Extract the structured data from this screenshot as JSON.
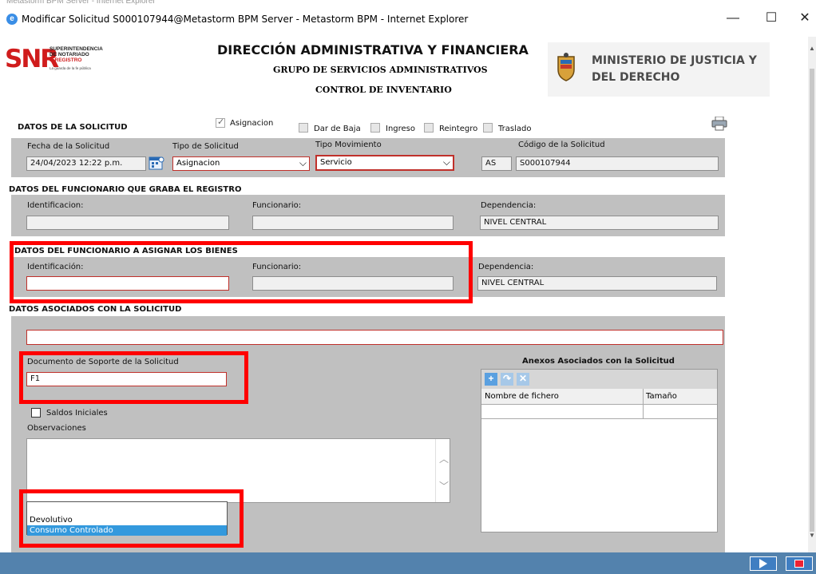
{
  "window": {
    "ghost_title": "Metastorm BPM Server - Internet Explorer",
    "title": "Modificar Solicitud S000107944@Metastorm BPM Server - Metastorm BPM - Internet Explorer",
    "minimize": "—",
    "maximize": "☐",
    "close": "✕"
  },
  "header": {
    "logo_big": "SNR",
    "logo_line1": "SUPERINTENDENCIA",
    "logo_line2": "DE NOTARIADO",
    "logo_line3": "& REGISTRO",
    "logo_tagline": "La guarda de la fe pública",
    "title": "DIRECCIÓN ADMINISTRATIVA Y FINANCIERA",
    "subtitle1": "GRUPO DE SERVICIOS ADMINISTRATIVOS",
    "subtitle2": "CONTROL DE INVENTARIO",
    "ministerio_line1": "MINISTERIO DE JUSTICIA Y",
    "ministerio_line2": "DEL DERECHO"
  },
  "solicitud": {
    "section": "DATOS DE LA SOLICITUD",
    "checkboxes": [
      {
        "label": "Asignacion",
        "checked": true
      },
      {
        "label": "Dar de Baja",
        "checked": false
      },
      {
        "label": "Ingreso",
        "checked": false
      },
      {
        "label": "Reintegro",
        "checked": false
      },
      {
        "label": "Traslado",
        "checked": false
      }
    ],
    "fecha_label": "Fecha de la Solicitud",
    "fecha_value": "24/04/2023 12:22 p.m.",
    "tipo_label": "Tipo de Solicitud",
    "tipo_value": "Asignacion",
    "movimiento_label": "Tipo Movimiento",
    "movimiento_value": "Servicio",
    "codigo_label": "Código de la Solicitud",
    "codigo_prefix": "AS",
    "codigo_value": "S000107944"
  },
  "graba": {
    "section": "DATOS DEL FUNCIONARIO QUE GRABA EL REGISTRO",
    "id_label": "Identificacion:",
    "funcionario_label": "Funcionario:",
    "dependencia_label": "Dependencia:",
    "id_value": "",
    "funcionario_value": "",
    "dependencia_value": "NIVEL CENTRAL"
  },
  "asignar": {
    "section": "DATOS DEL FUNCIONARIO A ASIGNAR LOS BIENES",
    "id_label": "Identificación:",
    "funcionario_label": "Funcionario:",
    "dependencia_label": "Dependencia:",
    "id_value": "",
    "funcionario_value": "",
    "dependencia_value": "NIVEL CENTRAL"
  },
  "asociados": {
    "section": "DATOS ASOCIADOS CON LA SOLICITUD",
    "documento_label": "Documento de Soporte de la Solicitud",
    "documento_value": "F1",
    "saldos_label": "Saldos Iniciales",
    "observaciones_label": "Observaciones",
    "observaciones_value": "",
    "anexos_title": "Anexos Asociados con la Solicitud",
    "col_nombre": "Nombre de fichero",
    "col_tamano": "Tamaño"
  },
  "dropdown": {
    "options": [
      "Devolutivo",
      "Consumo Controlado"
    ],
    "selected_index": 1
  },
  "colors": {
    "highlight": "#ff0000",
    "panel": "#c0c0c0",
    "statusbar": "#5382ad",
    "selection": "#3399dd"
  }
}
